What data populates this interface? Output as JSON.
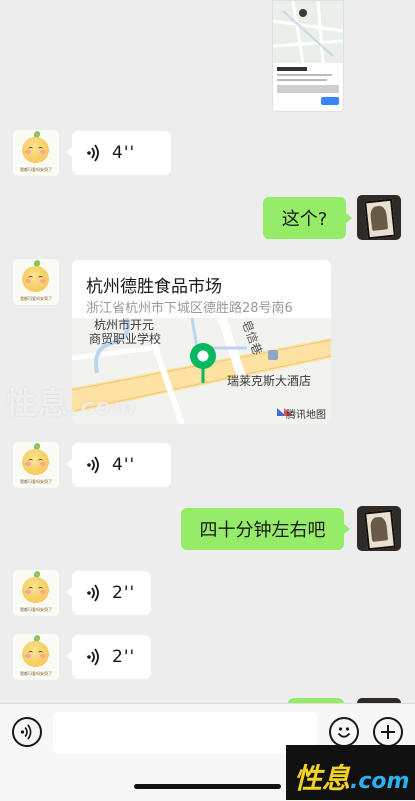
{
  "contact_avatar": {
    "caption": "我都可爱吗安哥了"
  },
  "messages": [
    {
      "id": "m1",
      "side": "left",
      "type": "voice",
      "duration": "4''"
    },
    {
      "id": "m2",
      "side": "right",
      "type": "text",
      "text": "这个?"
    },
    {
      "id": "m3",
      "side": "left",
      "type": "location",
      "title": "杭州德胜食品市场",
      "address": "浙江省杭州市下城区德胜路28号南6",
      "map_labels": {
        "school": "杭州市开元\n商贸职业学校",
        "street": "皂信巷",
        "hotel": "瑞莱克斯大酒店",
        "provider": "腾讯地图"
      }
    },
    {
      "id": "m4",
      "side": "left",
      "type": "voice",
      "duration": "4''"
    },
    {
      "id": "m5",
      "side": "right",
      "type": "text",
      "text": "四十分钟左右吧"
    },
    {
      "id": "m6",
      "side": "left",
      "type": "voice",
      "duration": "2''"
    },
    {
      "id": "m7",
      "side": "left",
      "type": "voice",
      "duration": "2''"
    }
  ],
  "watermark": {
    "brand": "性息",
    "domain": ".com"
  },
  "colors": {
    "self_bubble": "#95ec69",
    "other_bubble": "#ffffff",
    "background": "#ededed",
    "map_pin": "#07b85f"
  },
  "input": {
    "value": "",
    "placeholder": ""
  },
  "icons": {
    "voice_toggle": "voice-toggle-icon",
    "emoji": "emoji-icon",
    "more": "plus-icon"
  }
}
